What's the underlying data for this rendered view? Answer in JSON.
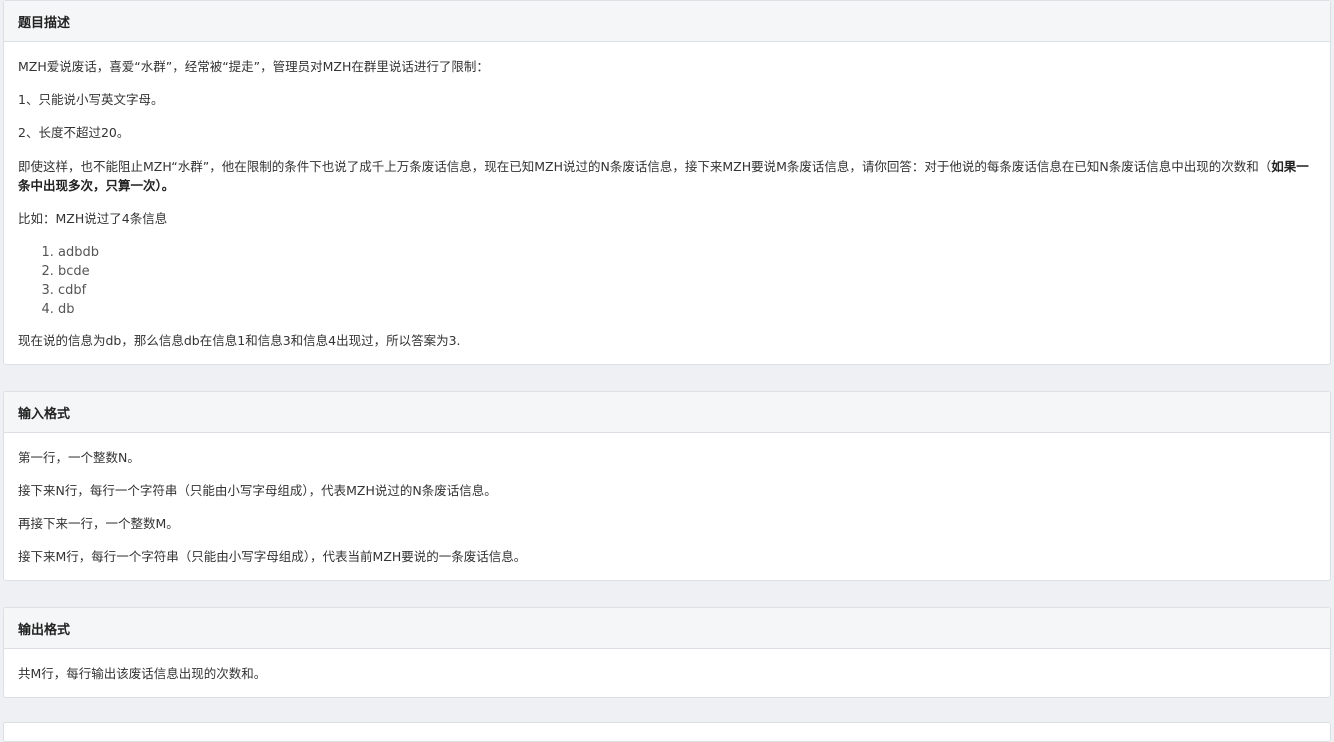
{
  "description": {
    "title": "题目描述",
    "p1": "MZH爱说废话，喜爱“水群”，经常被“提走”，管理员对MZH在群里说话进行了限制：",
    "p2": "1、只能说小写英文字母。",
    "p3": "2、长度不超过20。",
    "p4_start": "即使这样，也不能阻止MZH“水群”，他在限制的条件下也说了成千上万条废话信息，现在已知MZH说过的N条废话信息，接下来MZH要说M条废话信息，请你回答：对于他说的每条废话信息在已知N条废话信息中出现的次数和（",
    "p4_bold": "如果一条中出现多次，只算一次）。",
    "p5": "比如：MZH说过了4条信息",
    "examples": [
      "adbdb",
      "bcde",
      "cdbf",
      "db"
    ],
    "p6": "现在说的信息为db，那么信息db在信息1和信息3和信息4出现过，所以答案为3."
  },
  "input_format": {
    "title": "输入格式",
    "lines": [
      "第一行，一个整数N。",
      "接下来N行，每行一个字符串（只能由小写字母组成），代表MZH说过的N条废话信息。",
      "再接下来一行，一个整数M。",
      "接下来M行，每行一个字符串（只能由小写字母组成），代表当前MZH要说的一条废话信息。"
    ]
  },
  "output_format": {
    "title": "输出格式",
    "lines": [
      "共M行，每行输出该废话信息出现的次数和。"
    ]
  }
}
